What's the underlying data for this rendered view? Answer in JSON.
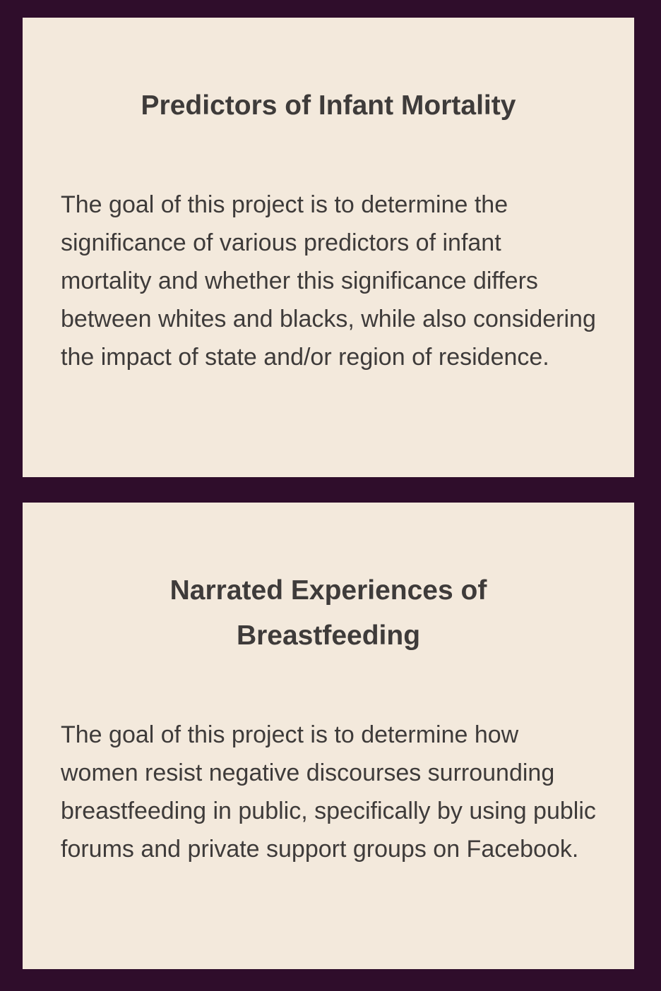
{
  "projects": [
    {
      "title": "Predictors of Infant Mortality",
      "description": "The goal of this project is to determine the significance of various predictors of infant mortality and whether this significance differs between whites and blacks, while also considering the impact of state and/or region of residence."
    },
    {
      "title": "Narrated Experiences of Breastfeeding",
      "description": "The goal of this project is to determine how women resist negative discourses surrounding breastfeeding in public, specifically by using public forums and private support groups on Facebook."
    }
  ],
  "colors": {
    "page_background": "#2f0d2b",
    "card_background": "#f3e9dc",
    "text": "#3e3b3a"
  }
}
